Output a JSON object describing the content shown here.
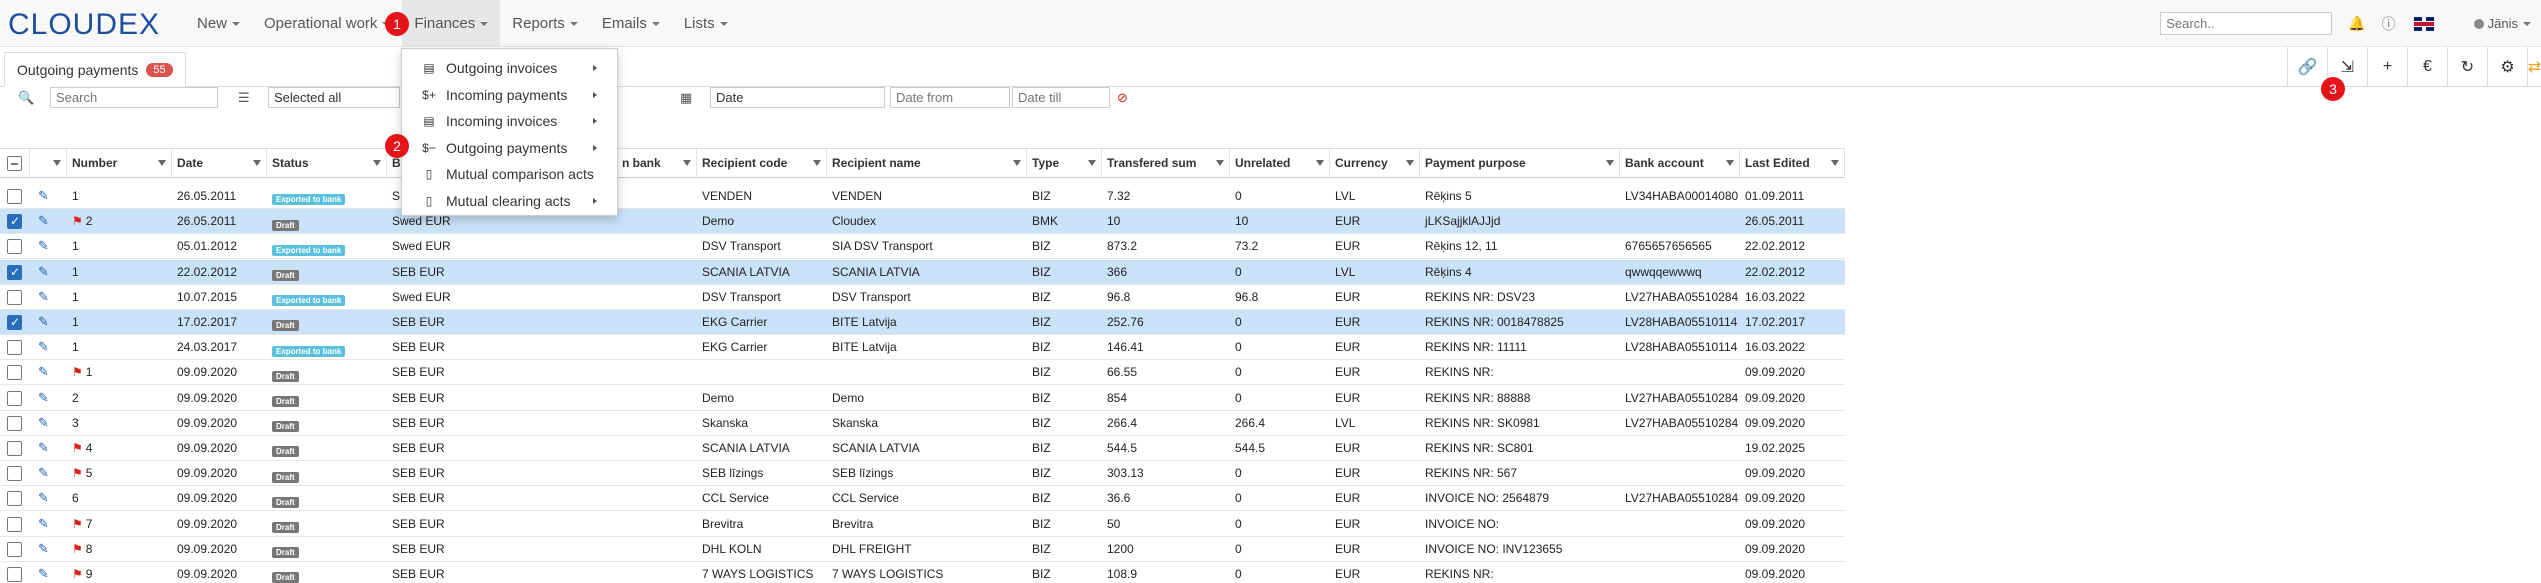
{
  "app": {
    "logo": "CLOUDEX",
    "nav": [
      {
        "label": "New"
      },
      {
        "label": "Operational work"
      },
      {
        "label": "Finances"
      },
      {
        "label": "Reports"
      },
      {
        "label": "Emails"
      },
      {
        "label": "Lists"
      }
    ],
    "search_placeholder": "Search..",
    "user": "Jānis"
  },
  "markers": [
    "1",
    "2",
    "3"
  ],
  "tab": {
    "label": "Outgoing payments",
    "count": "55"
  },
  "filters": {
    "search_placeholder": "Search",
    "selected": "Selected all",
    "date_field": "Date",
    "date_from_placeholder": "Date from",
    "date_till_placeholder": "Date till"
  },
  "finances_menu": [
    {
      "label": "Outgoing invoices",
      "icon": "file-invoice-icon"
    },
    {
      "label": "Incoming payments",
      "icon": "dollar-plus-icon"
    },
    {
      "label": "Incoming invoices",
      "icon": "file-invoice-icon"
    },
    {
      "label": "Outgoing payments",
      "icon": "dollar-minus-icon"
    },
    {
      "label": "Mutual comparison acts",
      "icon": "file-icon"
    },
    {
      "label": "Mutual clearing acts",
      "icon": "file-icon"
    }
  ],
  "columns": [
    "Number",
    "Date",
    "Status",
    "B",
    "n bank",
    "Recipient code",
    "Recipient name",
    "Type",
    "Transfered sum",
    "Unrelated",
    "Currency",
    "Payment purpose",
    "Bank account",
    "Last Edited"
  ],
  "rows": [
    {
      "sel": false,
      "flag": false,
      "number": "1",
      "date": "26.05.2011",
      "status": "Exported to bank",
      "bank": "S",
      "rcode": "VENDEN",
      "rname": "VENDEN",
      "type": "BIZ",
      "sum": "7.32",
      "unrel": "0",
      "cur": "LVL",
      "purpose": "Rēķins 5",
      "acct": "LV34HABA00014080",
      "edited": "01.09.2011"
    },
    {
      "sel": true,
      "flag": true,
      "number": "2",
      "date": "26.05.2011",
      "status": "Draft",
      "bank": "Swed EUR",
      "rcode": "Demo",
      "rname": "Cloudex",
      "type": "BMK",
      "sum": "10",
      "unrel": "10",
      "cur": "EUR",
      "purpose": "jLKSajjklAJJjd",
      "acct": "",
      "edited": "26.05.2011"
    },
    {
      "sel": false,
      "flag": false,
      "number": "1",
      "date": "05.01.2012",
      "status": "Exported to bank",
      "bank": "Swed EUR",
      "rcode": "DSV Transport",
      "rname": "SIA DSV Transport",
      "type": "BIZ",
      "sum": "873.2",
      "unrel": "73.2",
      "cur": "EUR",
      "purpose": "Rēķins 12, 11",
      "acct": "6765657656565",
      "edited": "22.02.2012"
    },
    {
      "sel": true,
      "flag": false,
      "number": "1",
      "date": "22.02.2012",
      "status": "Draft",
      "bank": "SEB EUR",
      "rcode": "SCANIA LATVIA",
      "rname": "SCANIA LATVIA",
      "type": "BIZ",
      "sum": "366",
      "unrel": "0",
      "cur": "LVL",
      "purpose": "Rēķins 4",
      "acct": "qwwqqewwwq",
      "edited": "22.02.2012"
    },
    {
      "sel": false,
      "flag": false,
      "number": "1",
      "date": "10.07.2015",
      "status": "Exported to bank",
      "bank": "Swed EUR",
      "rcode": "DSV Transport",
      "rname": "DSV Transport",
      "type": "BIZ",
      "sum": "96.8",
      "unrel": "96.8",
      "cur": "EUR",
      "purpose": "REKINS NR: DSV23",
      "acct": "LV27HABA05510284",
      "edited": "16.03.2022"
    },
    {
      "sel": true,
      "flag": false,
      "number": "1",
      "date": "17.02.2017",
      "status": "Draft",
      "bank": "SEB EUR",
      "rcode": "EKG Carrier",
      "rname": "BITE Latvija",
      "type": "BIZ",
      "sum": "252.76",
      "unrel": "0",
      "cur": "EUR",
      "purpose": "REKINS NR: 0018478825",
      "acct": "LV28HABA05510114",
      "edited": "17.02.2017"
    },
    {
      "sel": false,
      "flag": false,
      "number": "1",
      "date": "24.03.2017",
      "status": "Exported to bank",
      "bank": "SEB EUR",
      "rcode": "EKG Carrier",
      "rname": "BITE Latvija",
      "type": "BIZ",
      "sum": "146.41",
      "unrel": "0",
      "cur": "EUR",
      "purpose": "REKINS NR: 11111",
      "acct": "LV28HABA05510114",
      "edited": "16.03.2022"
    },
    {
      "sel": false,
      "flag": true,
      "number": "1",
      "date": "09.09.2020",
      "status": "Draft",
      "bank": "SEB EUR",
      "rcode": "",
      "rname": "",
      "type": "BIZ",
      "sum": "66.55",
      "unrel": "0",
      "cur": "EUR",
      "purpose": "REKINS NR:",
      "acct": "",
      "edited": "09.09.2020"
    },
    {
      "sel": false,
      "flag": false,
      "number": "2",
      "date": "09.09.2020",
      "status": "Draft",
      "bank": "SEB EUR",
      "rcode": "Demo",
      "rname": "Demo",
      "type": "BIZ",
      "sum": "854",
      "unrel": "0",
      "cur": "EUR",
      "purpose": "REKINS NR: 88888",
      "acct": "LV27HABA05510284",
      "edited": "09.09.2020"
    },
    {
      "sel": false,
      "flag": false,
      "number": "3",
      "date": "09.09.2020",
      "status": "Draft",
      "bank": "SEB EUR",
      "rcode": "Skanska",
      "rname": "Skanska",
      "type": "BIZ",
      "sum": "266.4",
      "unrel": "266.4",
      "cur": "LVL",
      "purpose": "REKINS NR: SK0981",
      "acct": "LV27HABA05510284",
      "edited": "09.09.2020"
    },
    {
      "sel": false,
      "flag": true,
      "number": "4",
      "date": "09.09.2020",
      "status": "Draft",
      "bank": "SEB EUR",
      "rcode": "SCANIA LATVIA",
      "rname": "SCANIA LATVIA",
      "type": "BIZ",
      "sum": "544.5",
      "unrel": "544.5",
      "cur": "EUR",
      "purpose": "REKINS NR: SC801",
      "acct": "",
      "edited": "19.02.2025"
    },
    {
      "sel": false,
      "flag": true,
      "number": "5",
      "date": "09.09.2020",
      "status": "Draft",
      "bank": "SEB EUR",
      "rcode": "SEB līzings",
      "rname": "SEB līzings",
      "type": "BIZ",
      "sum": "303.13",
      "unrel": "0",
      "cur": "EUR",
      "purpose": "REKINS NR: 567",
      "acct": "",
      "edited": "09.09.2020"
    },
    {
      "sel": false,
      "flag": false,
      "number": "6",
      "date": "09.09.2020",
      "status": "Draft",
      "bank": "SEB EUR",
      "rcode": "CCL Service",
      "rname": "CCL Service",
      "type": "BIZ",
      "sum": "36.6",
      "unrel": "0",
      "cur": "EUR",
      "purpose": "INVOICE NO: 2564879",
      "acct": "LV27HABA05510284",
      "edited": "09.09.2020"
    },
    {
      "sel": false,
      "flag": true,
      "number": "7",
      "date": "09.09.2020",
      "status": "Draft",
      "bank": "SEB EUR",
      "rcode": "Brevitra",
      "rname": "Brevitra",
      "type": "BIZ",
      "sum": "50",
      "unrel": "0",
      "cur": "EUR",
      "purpose": "INVOICE NO:",
      "acct": "",
      "edited": "09.09.2020"
    },
    {
      "sel": false,
      "flag": true,
      "number": "8",
      "date": "09.09.2020",
      "status": "Draft",
      "bank": "SEB EUR",
      "rcode": "DHL KOLN",
      "rname": "DHL FREIGHT",
      "type": "BIZ",
      "sum": "1200",
      "unrel": "0",
      "cur": "EUR",
      "purpose": "INVOICE NO: INV123655",
      "acct": "",
      "edited": "09.09.2020"
    },
    {
      "sel": false,
      "flag": true,
      "number": "9",
      "date": "09.09.2020",
      "status": "Draft",
      "bank": "SEB EUR",
      "rcode": "7 WAYS LOGISTICS",
      "rname": "7 WAYS LOGISTICS",
      "type": "BIZ",
      "sum": "108.9",
      "unrel": "0",
      "cur": "EUR",
      "purpose": "REKINS NR:",
      "acct": "",
      "edited": "09.09.2020"
    }
  ]
}
